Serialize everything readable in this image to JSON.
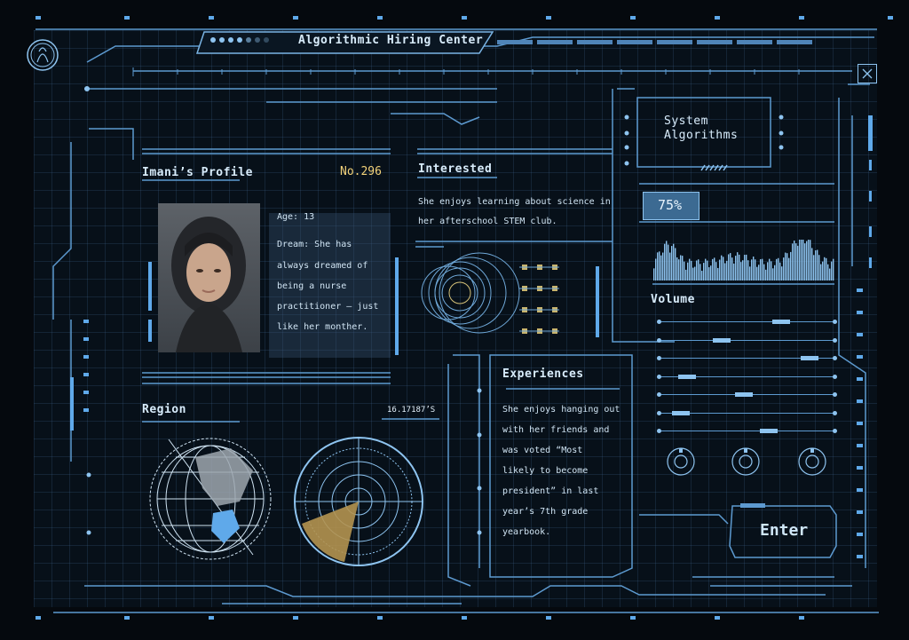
{
  "header": {
    "title": "Algorithmic Hiring Center"
  },
  "profile": {
    "title": "Imani’s Profile",
    "number": "No.296",
    "photo_icon": "portrait-photo",
    "age": "Age: 13",
    "dream_lines": [
      "Dream: She has",
      "always dreamed of",
      "being a nurse",
      "practitioner — just",
      "like her monther."
    ]
  },
  "interested": {
    "title": "Interested",
    "lines": [
      "She enjoys learning about science in",
      "her afterschool STEM club."
    ]
  },
  "system": {
    "title_lines": [
      "System",
      "Algorithms"
    ],
    "percent": "75%",
    "percent_value": 0.75
  },
  "volume": {
    "title": "Volume",
    "slider_positions": [
      0.72,
      0.34,
      0.9,
      0.12,
      0.48,
      0.08,
      0.64
    ]
  },
  "region": {
    "title": "Region",
    "coordinate": "16.17187’S"
  },
  "experiences": {
    "title": "Experiences",
    "lines": [
      "She enjoys hanging out",
      "with her friends and",
      "was voted “Most",
      "likely to become",
      "president” in last",
      "year’s 7th grade",
      "yearbook."
    ]
  },
  "enter_button": {
    "label": "Enter"
  },
  "colors": {
    "accent": "#8ec4f0",
    "number": "#f2d27a",
    "radar": "#b49450",
    "background": "#05090e"
  }
}
